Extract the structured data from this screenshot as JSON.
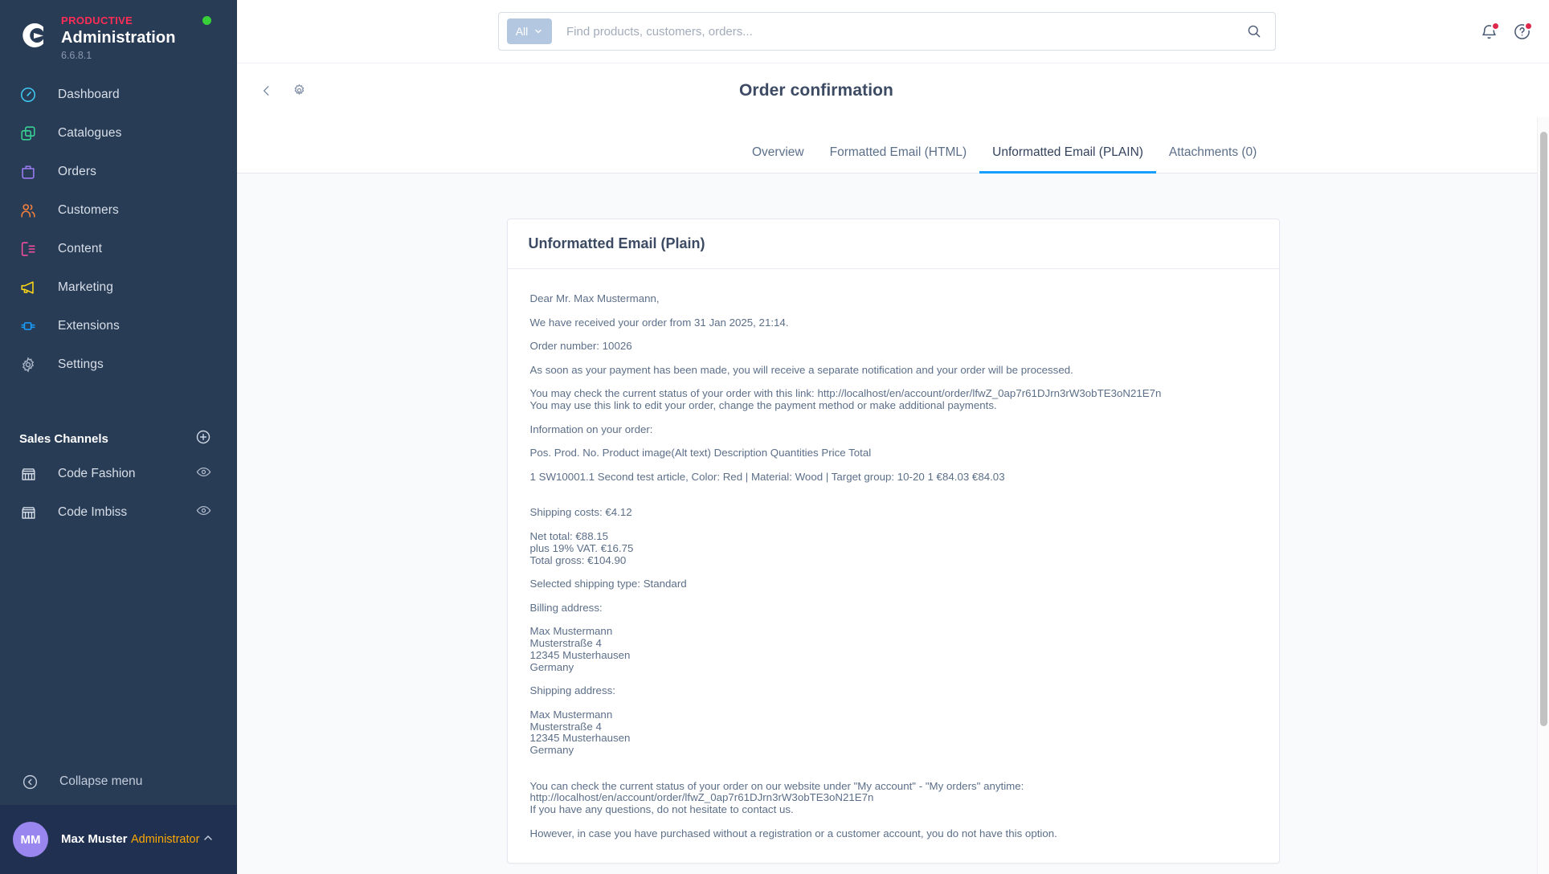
{
  "sidebar": {
    "brand": {
      "kicker": "PRODUCTIVE",
      "title": "Administration",
      "version": "6.6.8.1",
      "status_color": "#37d039",
      "accent_color": "#ff2d55"
    },
    "items": [
      {
        "label": "Dashboard",
        "icon": "dashboard-icon",
        "color": "#3ec8f0"
      },
      {
        "label": "Catalogues",
        "icon": "catalogues-icon",
        "color": "#37d093"
      },
      {
        "label": "Orders",
        "icon": "orders-icon",
        "color": "#9a7cf0"
      },
      {
        "label": "Customers",
        "icon": "customers-icon",
        "color": "#f5813c"
      },
      {
        "label": "Content",
        "icon": "content-icon",
        "color": "#f04d9c"
      },
      {
        "label": "Marketing",
        "icon": "marketing-icon",
        "color": "#fbd516"
      },
      {
        "label": "Extensions",
        "icon": "extensions-icon",
        "color": "#189eff"
      },
      {
        "label": "Settings",
        "icon": "settings-icon",
        "color": "#a8b4c5"
      }
    ],
    "sales_channels": {
      "title": "Sales Channels",
      "add_label": "+",
      "items": [
        {
          "label": "Code Fashion"
        },
        {
          "label": "Code Imbiss"
        }
      ]
    },
    "collapse_label": "Collapse menu",
    "user": {
      "initials": "MM",
      "name": "Max Muster",
      "role": "Administrator",
      "role_color": "#ffa801"
    }
  },
  "topbar": {
    "scope_label": "All",
    "search_placeholder": "Find products, customers, orders...",
    "search_value": "",
    "notifications_has_badge": true,
    "help_has_badge": true,
    "badge_color": "#de294c"
  },
  "pagehead": {
    "title": "Order confirmation"
  },
  "tabs": [
    {
      "label": "Overview",
      "active": false
    },
    {
      "label": "Formatted Email (HTML)",
      "active": false
    },
    {
      "label": "Unformatted Email (PLAIN)",
      "active": true
    },
    {
      "label": "Attachments (0)",
      "active": false
    }
  ],
  "card": {
    "title": "Unformatted Email (Plain)",
    "body": "Dear Mr. Max Mustermann,\n\nWe have received your order from 31 Jan 2025, 21:14.\n\nOrder number: 10026\n\nAs soon as your payment has been made, you will receive a separate notification and your order will be processed.\n\nYou may check the current status of your order with this link: http://localhost/en/account/order/lfwZ_0ap7r61DJrn3rW3obTE3oN21E7n\nYou may use this link to edit your order, change the payment method or make additional payments.\n\nInformation on your order:\n\nPos. Prod. No. Product image(Alt text) Description Quantities Price Total\n\n1 SW10001.1 Second test article, Color: Red | Material: Wood | Target group: 10-20 1 €84.03 €84.03\n\n\nShipping costs: €4.12\n\nNet total: €88.15\nplus 19% VAT. €16.75\nTotal gross: €104.90\n\nSelected shipping type: Standard\n\nBilling address:\n\nMax Mustermann\nMusterstraße 4\n12345 Musterhausen\nGermany\n\nShipping address:\n\nMax Mustermann\nMusterstraße 4\n12345 Musterhausen\nGermany\n\n\nYou can check the current status of your order on our website under \"My account\" - \"My orders\" anytime: http://localhost/en/account/order/lfwZ_0ap7r61DJrn3rW3obTE3oN21E7n\nIf you have any questions, do not hesitate to contact us.\n\nHowever, in case you have purchased without a registration or a customer account, you do not have this option."
  }
}
